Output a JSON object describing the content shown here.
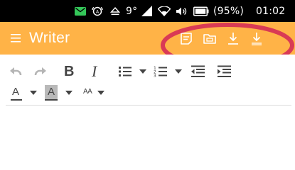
{
  "status_bar": {
    "temperature": "9°",
    "battery": "(95%)",
    "time": "01:02",
    "icons": [
      "message-icon",
      "alarm-icon",
      "eject-icon",
      "signal-icon",
      "wifi-icon",
      "volume-icon",
      "battery-icon"
    ]
  },
  "app_bar": {
    "title": "Writer",
    "background": "#ffb347",
    "actions": [
      "notes-icon",
      "folder-icon",
      "download-icon",
      "download-alt-icon"
    ]
  },
  "toolbar": {
    "buttons": [
      "undo-icon",
      "redo-icon",
      "bold-icon",
      "italic-icon",
      "bullet-list-icon",
      "numbered-list-icon",
      "outdent-icon",
      "indent-icon",
      "font-color-icon",
      "highlight-icon",
      "font-size-icon"
    ],
    "bold_label": "B",
    "italic_label": "I",
    "font_color_label": "A",
    "highlight_label": "A",
    "font_size_label": "AA"
  },
  "annotation": {
    "color": "#d93a55"
  }
}
